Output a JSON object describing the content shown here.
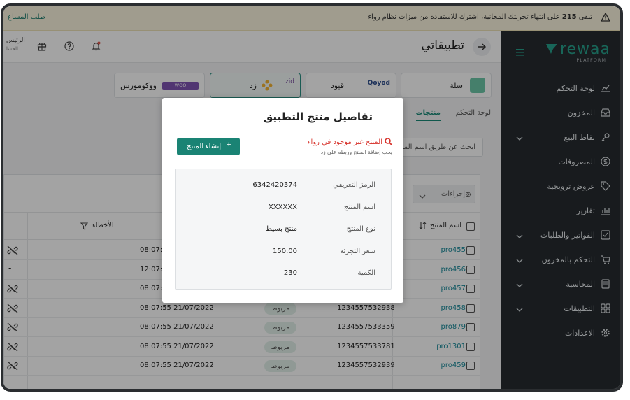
{
  "banner": {
    "message_prefix": "تبقى",
    "days": "215",
    "message_rest": "على انتهاء تجربتك المجانية، اشترك للاستفادة من ميزات نظام رواء",
    "request_link": "طلب المساع"
  },
  "sidebar": {
    "logo_word": "rewaa",
    "logo_sub": "PLATFORM",
    "items": [
      {
        "label": "لوحة التحكم",
        "icon": "chart-icon",
        "chevron": false
      },
      {
        "label": "المخزون",
        "icon": "inbox-icon",
        "chevron": false
      },
      {
        "label": "نقاط البيع",
        "icon": "key-icon",
        "chevron": true
      },
      {
        "label": "المصروفات",
        "icon": "dollar-icon",
        "chevron": false
      },
      {
        "label": "عروض ترويجية",
        "icon": "tag-icon",
        "chevron": false
      },
      {
        "label": "تقارير",
        "icon": "bar-chart-icon",
        "chevron": false
      },
      {
        "label": "الفواتير والطلبات",
        "icon": "check-square-icon",
        "chevron": true
      },
      {
        "label": "التحكم بالمخزون",
        "icon": "cart-icon",
        "chevron": true
      },
      {
        "label": "المحاسبة",
        "icon": "book-icon",
        "chevron": true
      },
      {
        "label": "التطبيقات",
        "icon": "grid-icon",
        "chevron": true
      },
      {
        "label": "الاعدادات",
        "icon": "gear-icon",
        "chevron": false
      }
    ]
  },
  "topbar": {
    "title": "تطبيقاتي",
    "user_name": "الرئيس",
    "user_sub": "الحسا"
  },
  "apps": {
    "salla": "سلة",
    "qoyod": "قيود",
    "zid": "زد",
    "woocommerce": "ووكومورس"
  },
  "tabs": {
    "dashboard": "لوحة التحكم",
    "products": "منتجات"
  },
  "search": {
    "placeholder": "ابحث عن طريق اسم المنتج"
  },
  "table": {
    "actions_label": "إجراءات",
    "col_product": "اسم المنتج",
    "col_errors": "الأخطاء",
    "rows": [
      {
        "product": "pro455",
        "code": "",
        "status": "",
        "date": "08:07:5",
        "link": "link"
      },
      {
        "product": "pro456",
        "code": "",
        "status": "",
        "date": "12:07:5",
        "link": "-"
      },
      {
        "product": "pro457",
        "code": "",
        "status": "",
        "date": "08:07:5",
        "link": "link"
      },
      {
        "product": "pro458",
        "code": "1234557532938",
        "status": "مربوط",
        "date": "08:07:55 21/07/2022",
        "link": "link"
      },
      {
        "product": "pro879",
        "code": "1234557533359",
        "status": "مربوط",
        "date": "08:07:55 21/07/2022",
        "link": "link"
      },
      {
        "product": "pro1301",
        "code": "1234557533781",
        "status": "مربوط",
        "date": "08:07:55 21/07/2022",
        "link": "link"
      },
      {
        "product": "pro459",
        "code": "1234557532939",
        "status": "مربوط",
        "date": "08:07:55 21/07/2022",
        "link": "link"
      }
    ]
  },
  "modal": {
    "title": "تفاصيل منتج التطبيق",
    "warning": "المنتج غير موجود في رواء",
    "hint": "يجب إضافة المنتج وربطه على زد",
    "create_button": "إنشاء المنتج",
    "details": [
      {
        "label": "الرمز التعريفي",
        "value": "6342420374"
      },
      {
        "label": "اسم المنتج",
        "value": "XXXXXX"
      },
      {
        "label": "نوع المنتج",
        "value": "منتج بسيط"
      },
      {
        "label": "سعر التجزئة",
        "value": "150.00"
      },
      {
        "label": "الكمية",
        "value": "230"
      }
    ]
  },
  "colors": {
    "accent": "#1a8374",
    "sidebar_bg": "#262b2f",
    "warning_red": "#d7332c"
  }
}
